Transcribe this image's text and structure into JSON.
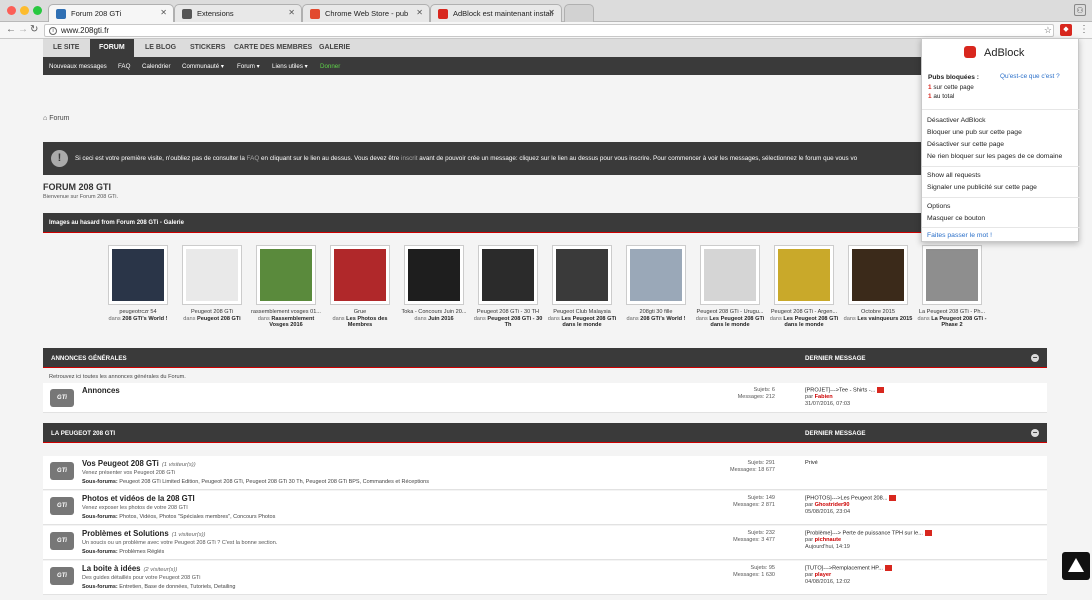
{
  "browser": {
    "tabs": [
      {
        "title": "Forum 208 GTi",
        "favicon_color": "#2f6fb3",
        "active": true
      },
      {
        "title": "Extensions",
        "favicon_color": "#555555",
        "active": false
      },
      {
        "title": "Chrome Web Store - pub",
        "favicon_color": "#e24a2f",
        "active": false
      },
      {
        "title": "AdBlock est maintenant install",
        "favicon_color": "#d8271e",
        "active": false
      }
    ],
    "url": "www.208gti.fr"
  },
  "site": {
    "topnav": [
      "LE SITE",
      "FORUM",
      "LE BLOG",
      "STICKERS",
      "CARTE DES MEMBRES",
      "GALERIE"
    ],
    "subnav": [
      "Nouveaux messages",
      "FAQ",
      "Calendrier",
      "Communauté ▾",
      "Forum ▾",
      "Liens utiles ▾",
      "Donner"
    ],
    "breadcrumb": "Forum",
    "notice": {
      "part1": "Si ceci est votre première visite, n'oubliez pas de consulter la ",
      "faq": "FAQ",
      "part2": " en cliquant sur le lien au dessus. Vous devez être ",
      "inscrit": "inscrit",
      "part3": " avant de pouvoir crée un message: cliquez sur le lien au dessus pour vous inscrire. Pour commencer à voir les messages, sélectionnez le forum que vous vo"
    },
    "forum_title": "FORUM 208 GTI",
    "forum_subtitle": "Bienvenue sur Forum 208 GTi.",
    "gallery_title": "Images au hasard from Forum 208 GTi - Galerie",
    "gallery": [
      {
        "caption": "peugeotrczr 54",
        "dans": "dans",
        "album": "208 GTi's World !",
        "img": "#2a3548"
      },
      {
        "caption": "Peugeot 208 GTi",
        "dans": "dans",
        "album": "Peugeot 208 GTi",
        "img": "#e9e9e9"
      },
      {
        "caption": "rassemblement vosges 01...",
        "dans": "dans",
        "album": "Rassemblement Vosges 2016",
        "img": "#5a8a3c"
      },
      {
        "caption": "Grue",
        "dans": "dans",
        "album": "Les Photos des Membres",
        "img": "#b0282a"
      },
      {
        "caption": "Toka - Concours Juin 20...",
        "dans": "dans",
        "album": "Juin 2016",
        "img": "#1e1e1e"
      },
      {
        "caption": "Peugeot 208 GTi - 30 TH",
        "dans": "dans",
        "album": "Peugeot 208 GTi - 30 Th",
        "img": "#2b2b2b"
      },
      {
        "caption": "Peugeot Club Malaysia",
        "dans": "dans",
        "album": "Les Peugeot 208 GTi dans le monde",
        "img": "#3a3a3a"
      },
      {
        "caption": "208gti 30 fille",
        "dans": "dans",
        "album": "208 GTi's World !",
        "img": "#9aa8b8"
      },
      {
        "caption": "Peugeot 208 GTi - Urugu...",
        "dans": "dans",
        "album": "Les Peugeot 208 GTi dans le monde",
        "img": "#d5d5d5"
      },
      {
        "caption": "Peugeot 208 GTi - Argen...",
        "dans": "dans",
        "album": "Les Peugeot 208 GTi dans le monde",
        "img": "#c9a92a"
      },
      {
        "caption": "Octobre 2015",
        "dans": "dans",
        "album": "Les vainqueurs 2015",
        "img": "#3b2a1a"
      },
      {
        "caption": "La Peugeot 208 GTi - Ph...",
        "dans": "dans",
        "album": "La Peugeot 208 GTi - Phase 2",
        "img": "#8e8e8e"
      }
    ],
    "cat1": {
      "name": "ANNONCES GÉNÉRALES",
      "last": "DERNIER MESSAGE",
      "desc": "Retrouvez ici toutes les annonces générales du Forum.",
      "forums": [
        {
          "title": "Annonces",
          "visitors": "",
          "desc": "",
          "subs_label": "",
          "subs": "",
          "stats1": "Sujets: 6",
          "stats2": "Messages: 212",
          "last_title": "[PROJET]--->Tee - Shirts -...",
          "last_by": "par ",
          "last_author": "Fabien",
          "last_date": "31/07/2016, 07:03"
        }
      ]
    },
    "cat2": {
      "name": "LA PEUGEOT 208 GTI",
      "last": "DERNIER MESSAGE",
      "forums": [
        {
          "title": "Vos Peugeot 208 GTi",
          "visitors": "(1 visiteur(s))",
          "desc": "Venez présenter vos Peugeot 208 GTi",
          "subs_label": "Sous-forums:",
          "subs": "Peugeot 208 GTi Limited Edition,  Peugeot 208 GTi,  Peugeot 208 GTi 30 Th,  Peugeot 208 GTi BPS,  Commandes et Réceptions",
          "stats1": "Sujets: 291",
          "stats2": "Messages: 18 677",
          "last_title": "Privé",
          "last_by": "",
          "last_author": "",
          "last_date": ""
        },
        {
          "title": "Photos et vidéos de la 208 GTI",
          "visitors": "",
          "desc": "Venez exposer les photos de votre 208 GTI",
          "subs_label": "Sous-forums:",
          "subs": "Photos,  Vidéos,  Photos \"Spéciales membres\",  Concours Photos",
          "stats1": "Sujets: 149",
          "stats2": "Messages: 2 871",
          "last_title": "[PHOTOS]--->Les Peugeot 208...",
          "last_by": "par ",
          "last_author": "Ghostrider90",
          "last_date": "05/08/2016, 23:04"
        },
        {
          "title": "Problèmes et Solutions",
          "visitors": "(1 visiteur(s))",
          "desc": "Un soucis ou un problème avec votre Peugeot 208 GTi ? C'est la bonne section.",
          "subs_label": "Sous-forums:",
          "subs": "Problèmes Réglés",
          "stats1": "Sujets: 232",
          "stats2": "Messages: 3 477",
          "last_title": "[Problème]---> Perte de puissance TPH sur le...",
          "last_by": "par ",
          "last_author": "pichnaute",
          "last_date": "Aujourd'hui, 14:19"
        },
        {
          "title": "La boite à idées",
          "visitors": "(2 visiteur(s))",
          "desc": "Des guides détaillés pour votre Peugeot 208 GTi",
          "subs_label": "Sous-forums:",
          "subs": "Entretien,  Base de données,  Tutoriels,  Detailing",
          "stats1": "Sujets: 95",
          "stats2": "Messages: 1 630",
          "last_title": "[TUTO]--->Remplacement HP...",
          "last_by": "par ",
          "last_author": "player",
          "last_date": "04/08/2016, 12:02"
        }
      ]
    }
  },
  "adblock": {
    "brand": "AdBlock",
    "blocked_title": "Pubs bloquées :",
    "whats_this": "Qu'est-ce que c'est ?",
    "page_count": "1",
    "page_label": " sur cette page",
    "total_count": "1",
    "total_label": " au total",
    "menu": [
      "Désactiver AdBlock",
      "Bloquer une pub sur cette page",
      "Désactiver sur cette page",
      "Ne rien bloquer sur les pages de ce domaine",
      "Show all requests",
      "Signaler une publicité sur cette page",
      "Options",
      "Masquer ce bouton",
      "Faites passer le mot !"
    ],
    "brand_color": "#d8271e"
  }
}
